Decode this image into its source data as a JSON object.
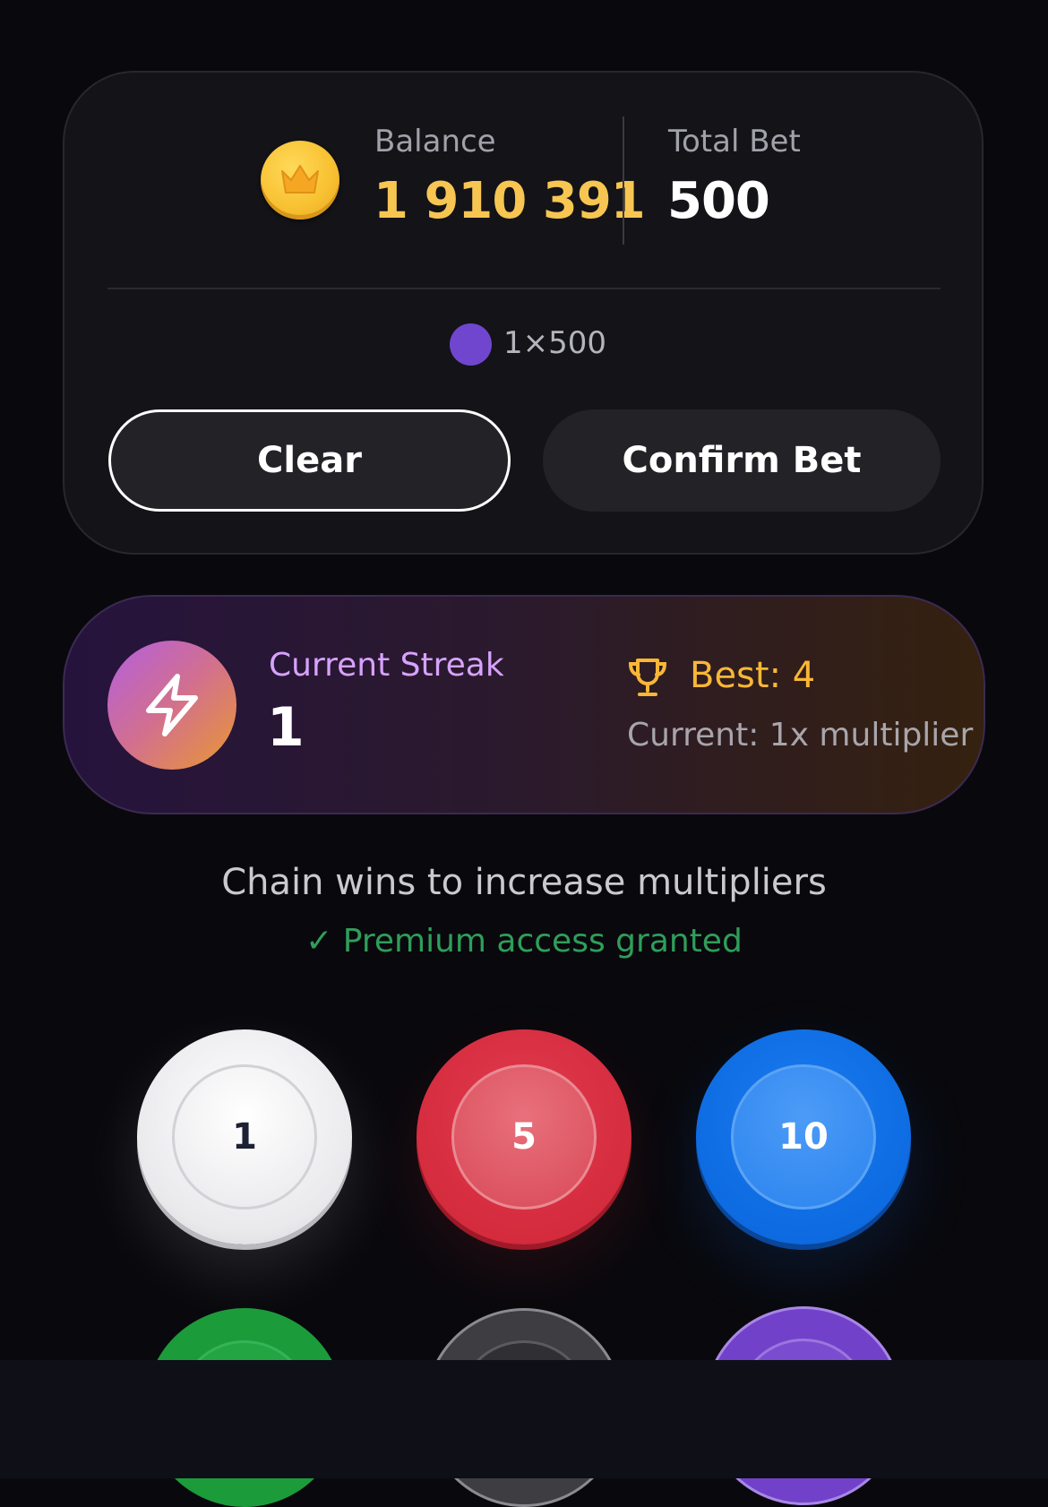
{
  "balance": {
    "label": "Balance",
    "value": "1 910 391"
  },
  "total_bet": {
    "label": "Total Bet",
    "value": "500"
  },
  "chip_summary": "1×500",
  "buttons": {
    "clear": "Clear",
    "confirm": "Confirm Bet"
  },
  "streak": {
    "label": "Current Streak",
    "value": "1",
    "best": "Best: 4",
    "multiplier": "Current: 1x multiplier"
  },
  "hint": "Chain wins to increase multipliers",
  "premium": "✓ Premium access granted",
  "chips": [
    {
      "value": "1",
      "color": "#ececef"
    },
    {
      "value": "5",
      "color": "#d42b3d"
    },
    {
      "value": "10",
      "color": "#0d6ae0"
    },
    {
      "value": "",
      "color": "#1c9b3b"
    },
    {
      "value": "",
      "color": "#3d3d42"
    },
    {
      "value": "",
      "color": "#7241c9"
    }
  ],
  "colors": {
    "gold": "#f7c552",
    "accent_purple": "#d7a2ff",
    "best_orange": "#f9b736",
    "success_green": "#2f9e5a"
  },
  "icons": [
    "crown-coin-icon",
    "lightning-icon",
    "trophy-icon"
  ]
}
